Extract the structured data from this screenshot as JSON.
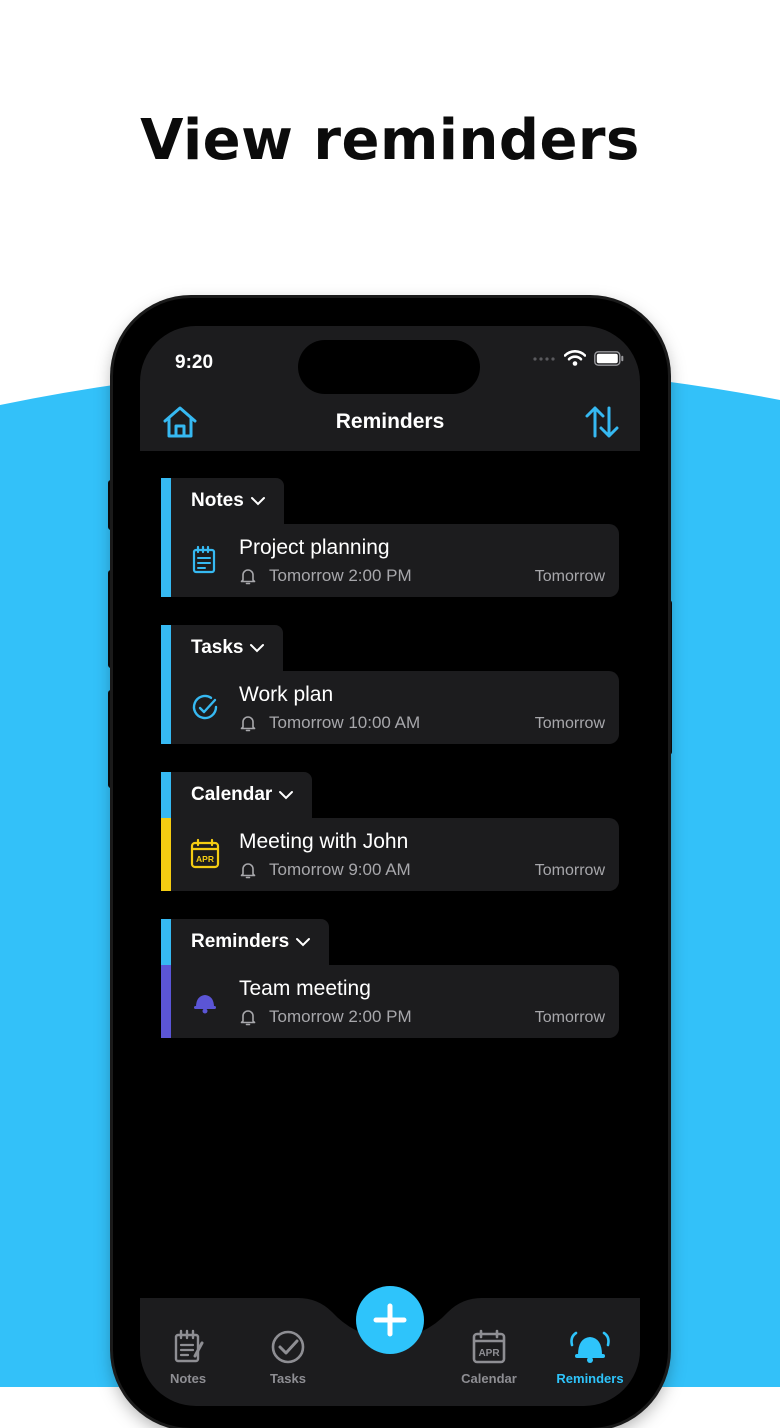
{
  "headline": "View reminders",
  "status": {
    "time": "9:20"
  },
  "nav": {
    "title": "Reminders"
  },
  "sections": [
    {
      "header": "Notes",
      "accent": "#36b9f2",
      "item": {
        "title": "Project planning",
        "reminder": "Tomorrow 2:00 PM",
        "when": "Tomorrow",
        "icon": "notepad-icon"
      }
    },
    {
      "header": "Tasks",
      "accent": "#36b9f2",
      "item": {
        "title": "Work plan",
        "reminder": "Tomorrow 10:00 AM",
        "when": "Tomorrow",
        "icon": "task-check-icon"
      }
    },
    {
      "header": "Calendar",
      "accent": "#f4cc12",
      "item": {
        "title": "Meeting with John",
        "reminder": "Tomorrow 9:00 AM",
        "when": "Tomorrow",
        "icon": "calendar-apr-icon"
      }
    },
    {
      "header": "Reminders",
      "accent": "#5b55d6",
      "item": {
        "title": "Team meeting",
        "reminder": "Tomorrow 2:00 PM",
        "when": "Tomorrow",
        "icon": "bell-icon"
      }
    }
  ],
  "tabs": [
    {
      "label": "Notes",
      "icon": "notepad-icon",
      "active": false
    },
    {
      "label": "Tasks",
      "icon": "check-circle-icon",
      "active": false
    },
    {
      "label": "Calendar",
      "icon": "calendar-apr-icon",
      "active": false
    },
    {
      "label": "Reminders",
      "icon": "bell-icon",
      "active": true
    }
  ],
  "calendar_icon_text": "APR",
  "colors": {
    "accent": "#2ec4fb",
    "background_wave": "#33c1f9",
    "inactive_tab": "#8e8e93"
  }
}
